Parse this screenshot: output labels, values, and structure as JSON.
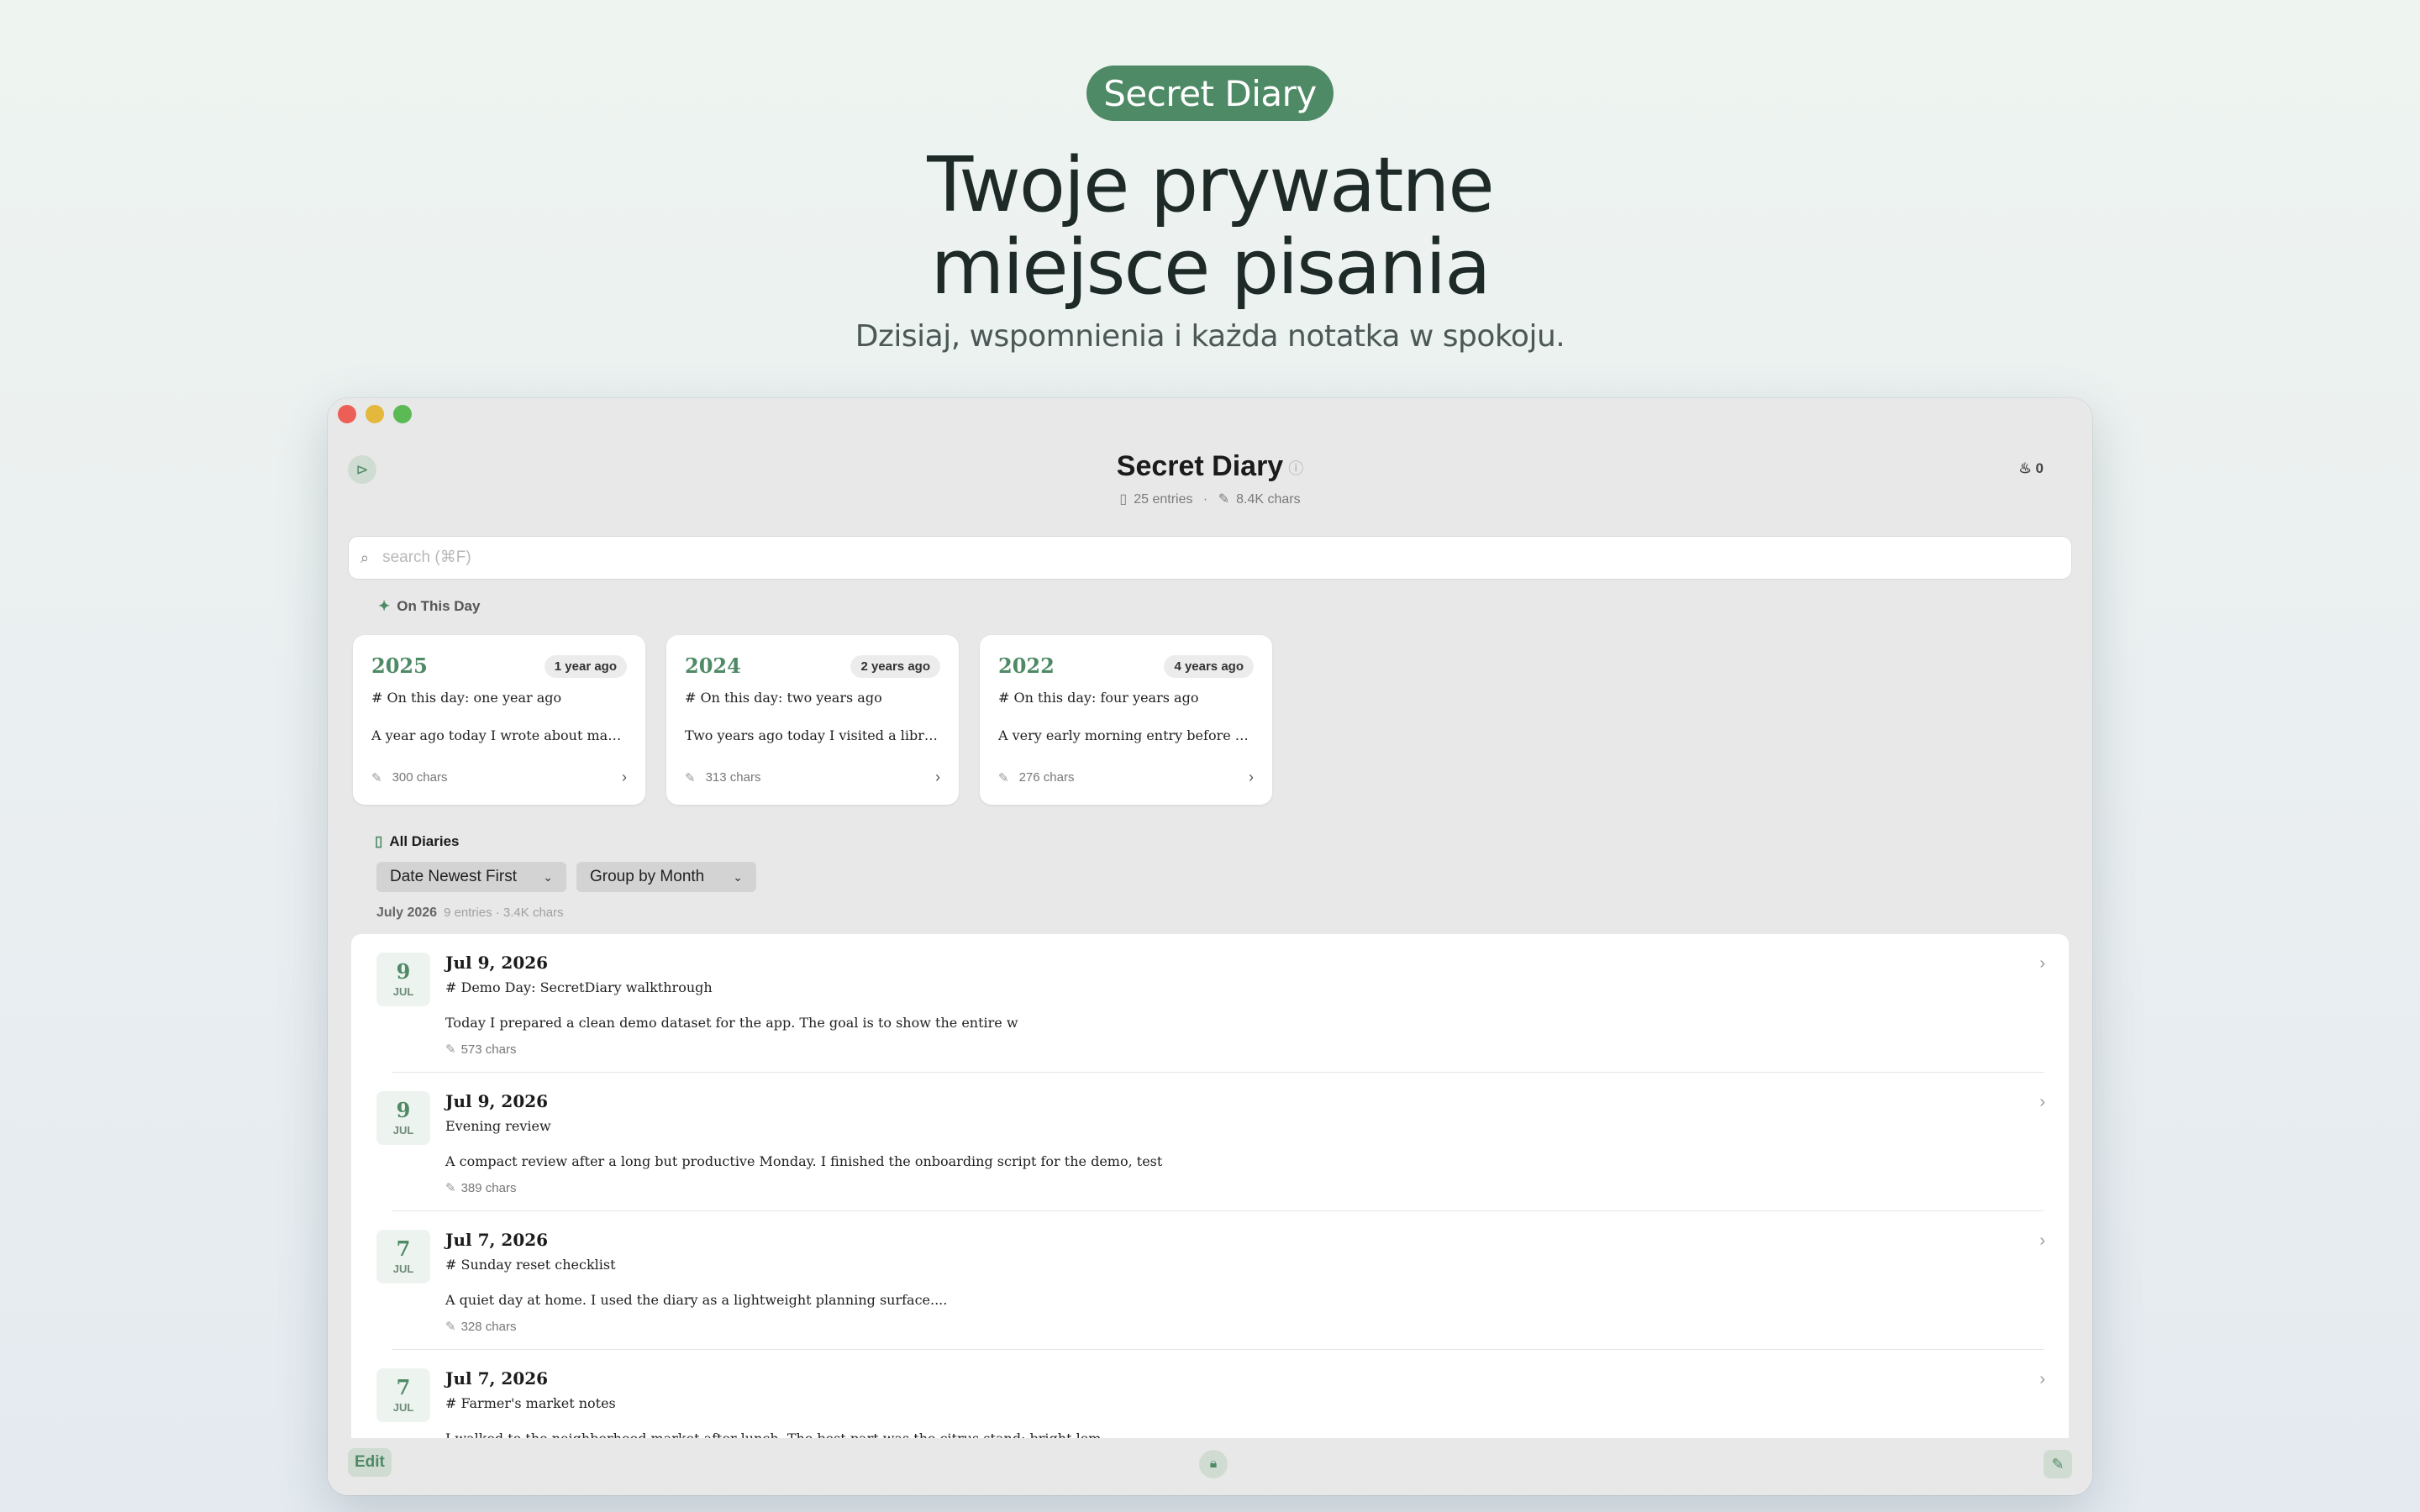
{
  "hero": {
    "badge": "Secret Diary",
    "headline_line1": "Twoje prywatne",
    "headline_line2": "miejsce pisania",
    "subline": "Dzisiaj, wspomnienia i każda notatka w spokoju."
  },
  "window": {
    "title": "Secret Diary",
    "entries_count": "25 entries",
    "chars_count": "8.4K chars",
    "flame_count": "0"
  },
  "search": {
    "placeholder": "search (⌘F)"
  },
  "on_this_day": {
    "label": "On This Day",
    "cards": [
      {
        "year": "2025",
        "badge": "1 year ago",
        "title": "# On this day: one year ago",
        "snippet": "A year ago today I wrote about makin...",
        "chars": "300 chars"
      },
      {
        "year": "2024",
        "badge": "2 years ago",
        "title": "# On this day: two years ago",
        "snippet": "Two years ago today I visited a library...",
        "chars": "313 chars"
      },
      {
        "year": "2022",
        "badge": "4 years ago",
        "title": "# On this day: four years ago",
        "snippet": "A very early morning entry before a tr...",
        "chars": "276 chars"
      }
    ]
  },
  "all_diaries": {
    "label": "All Diaries",
    "sort": "Date Newest First",
    "group": "Group by Month",
    "month": "July 2026",
    "month_meta": "9 entries · 3.4K chars",
    "entries": [
      {
        "day": "9",
        "mon": "JUL",
        "date": "Jul 9, 2026",
        "title": "# Demo Day: SecretDiary walkthrough",
        "snippet": "Today I prepared a clean demo dataset for the app. The goal is to show the entire w",
        "chars": "573 chars"
      },
      {
        "day": "9",
        "mon": "JUL",
        "date": "Jul 9, 2026",
        "title": "Evening review",
        "snippet": "A compact review after a long but productive Monday. I finished the onboarding script for the demo, test",
        "chars": "389 chars"
      },
      {
        "day": "7",
        "mon": "JUL",
        "date": "Jul 7, 2026",
        "title": "# Sunday reset checklist",
        "snippet": "A quiet day at home. I used the diary as a lightweight planning surface....",
        "chars": "328 chars"
      },
      {
        "day": "7",
        "mon": "JUL",
        "date": "Jul 7, 2026",
        "title": "# Farmer's market notes",
        "snippet": "I walked to the neighborhood market after lunch. The best part was the citrus stand: bright lem",
        "chars": ""
      }
    ]
  },
  "toolbar": {
    "edit_label": "Edit"
  },
  "icons": {
    "sidebar": "sidebar-toggle-icon",
    "info": "info-icon",
    "flame": "flame-icon",
    "search": "search-icon",
    "sparkle": "sparkle-icon",
    "book": "book-icon",
    "chars": "pen-icon",
    "chevron": "chevron-right-icon",
    "lock": "lock-icon",
    "compose": "compose-icon"
  },
  "colors": {
    "accent": "#4e8a65"
  }
}
